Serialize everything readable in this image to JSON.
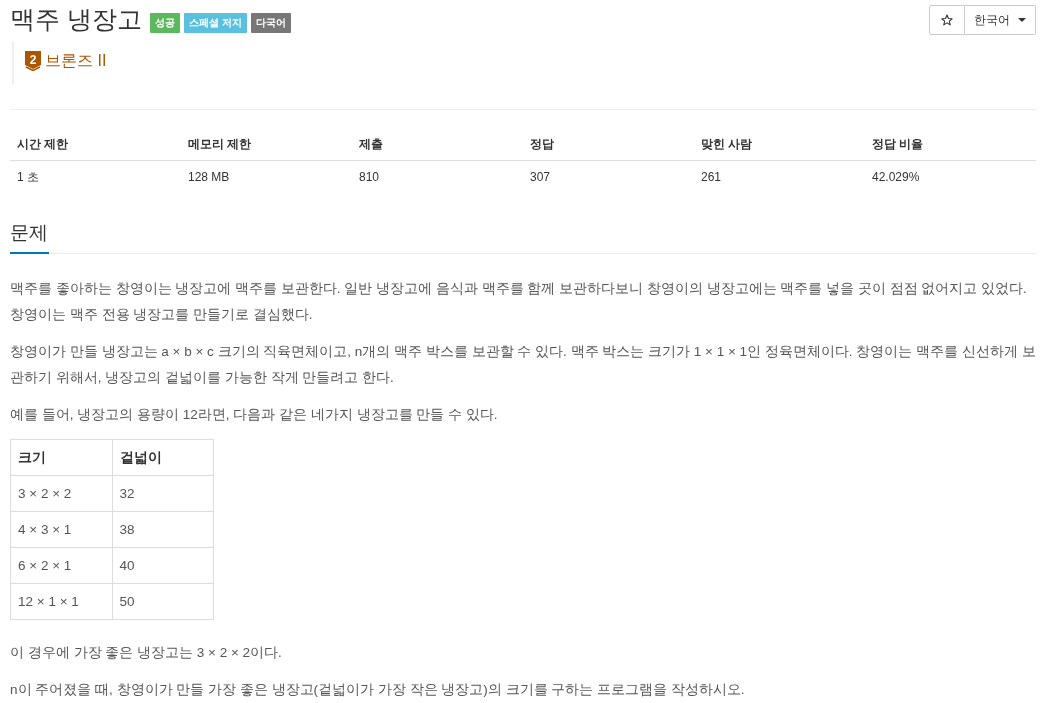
{
  "problem": {
    "title": "맥주 냉장고",
    "badges": [
      {
        "label": "성공",
        "color": "#5cb85c"
      },
      {
        "label": "스페셜 저지",
        "color": "#5bc0de"
      },
      {
        "label": "다국어",
        "color": "#777777"
      }
    ]
  },
  "tier": {
    "icon_text": "2",
    "label": "브론즈 II"
  },
  "language_dropdown": {
    "value": "한국어"
  },
  "stats": {
    "columns": [
      "시간 제한",
      "메모리 제한",
      "제출",
      "정답",
      "맞힌 사람",
      "정답 비율"
    ],
    "rows": [
      [
        "1 초",
        "128 MB",
        "810",
        "307",
        "261",
        "42.029%"
      ]
    ]
  },
  "section": {
    "heading": "문제",
    "content": [
      {
        "kind": "paragraph",
        "text": "맥주를 좋아하는 창영이는 냉장고에 맥주를 보관한다. 일반 냉장고에 음식과 맥주를 함께 보관하다보니 창영이의 냉장고에는 맥주를 넣을 곳이 점점 없어지고 있었다. 창영이는 맥주 전용 냉장고를 만들기로 결심했다."
      },
      {
        "kind": "paragraph",
        "text": "창영이가 만들 냉장고는 a × b × c 크기의 직육면체이고, n개의 맥주 박스를 보관할 수 있다. 맥주 박스는 크기가 1 × 1 × 1인 정육면체이다. 창영이는 맥주를 신선하게 보관하기 위해서, 냉장고의 겉넓이를 가능한 작게 만들려고 한다."
      },
      {
        "kind": "paragraph",
        "text": "예를 들어, 냉장고의 용량이 12라면, 다음과 같은 네가지 냉장고를 만들 수 있다."
      },
      {
        "kind": "table",
        "columns": [
          "크기",
          "겉넓이"
        ],
        "rows": [
          [
            "3 × 2 × 2",
            "32"
          ],
          [
            "4 × 3 × 1",
            "38"
          ],
          [
            "6 × 2 × 1",
            "40"
          ],
          [
            "12 × 1 × 1",
            "50"
          ]
        ]
      },
      {
        "kind": "paragraph",
        "text": "이 경우에 가장 좋은 냉장고는 3 × 2 × 2이다."
      },
      {
        "kind": "paragraph",
        "text": "n이 주어졌을 때, 창영이가 만들 가장 좋은 냉장고(겉넓이가 가장 작은 냉장고)의 크기를 구하는 프로그램을 작성하시오."
      }
    ]
  }
}
